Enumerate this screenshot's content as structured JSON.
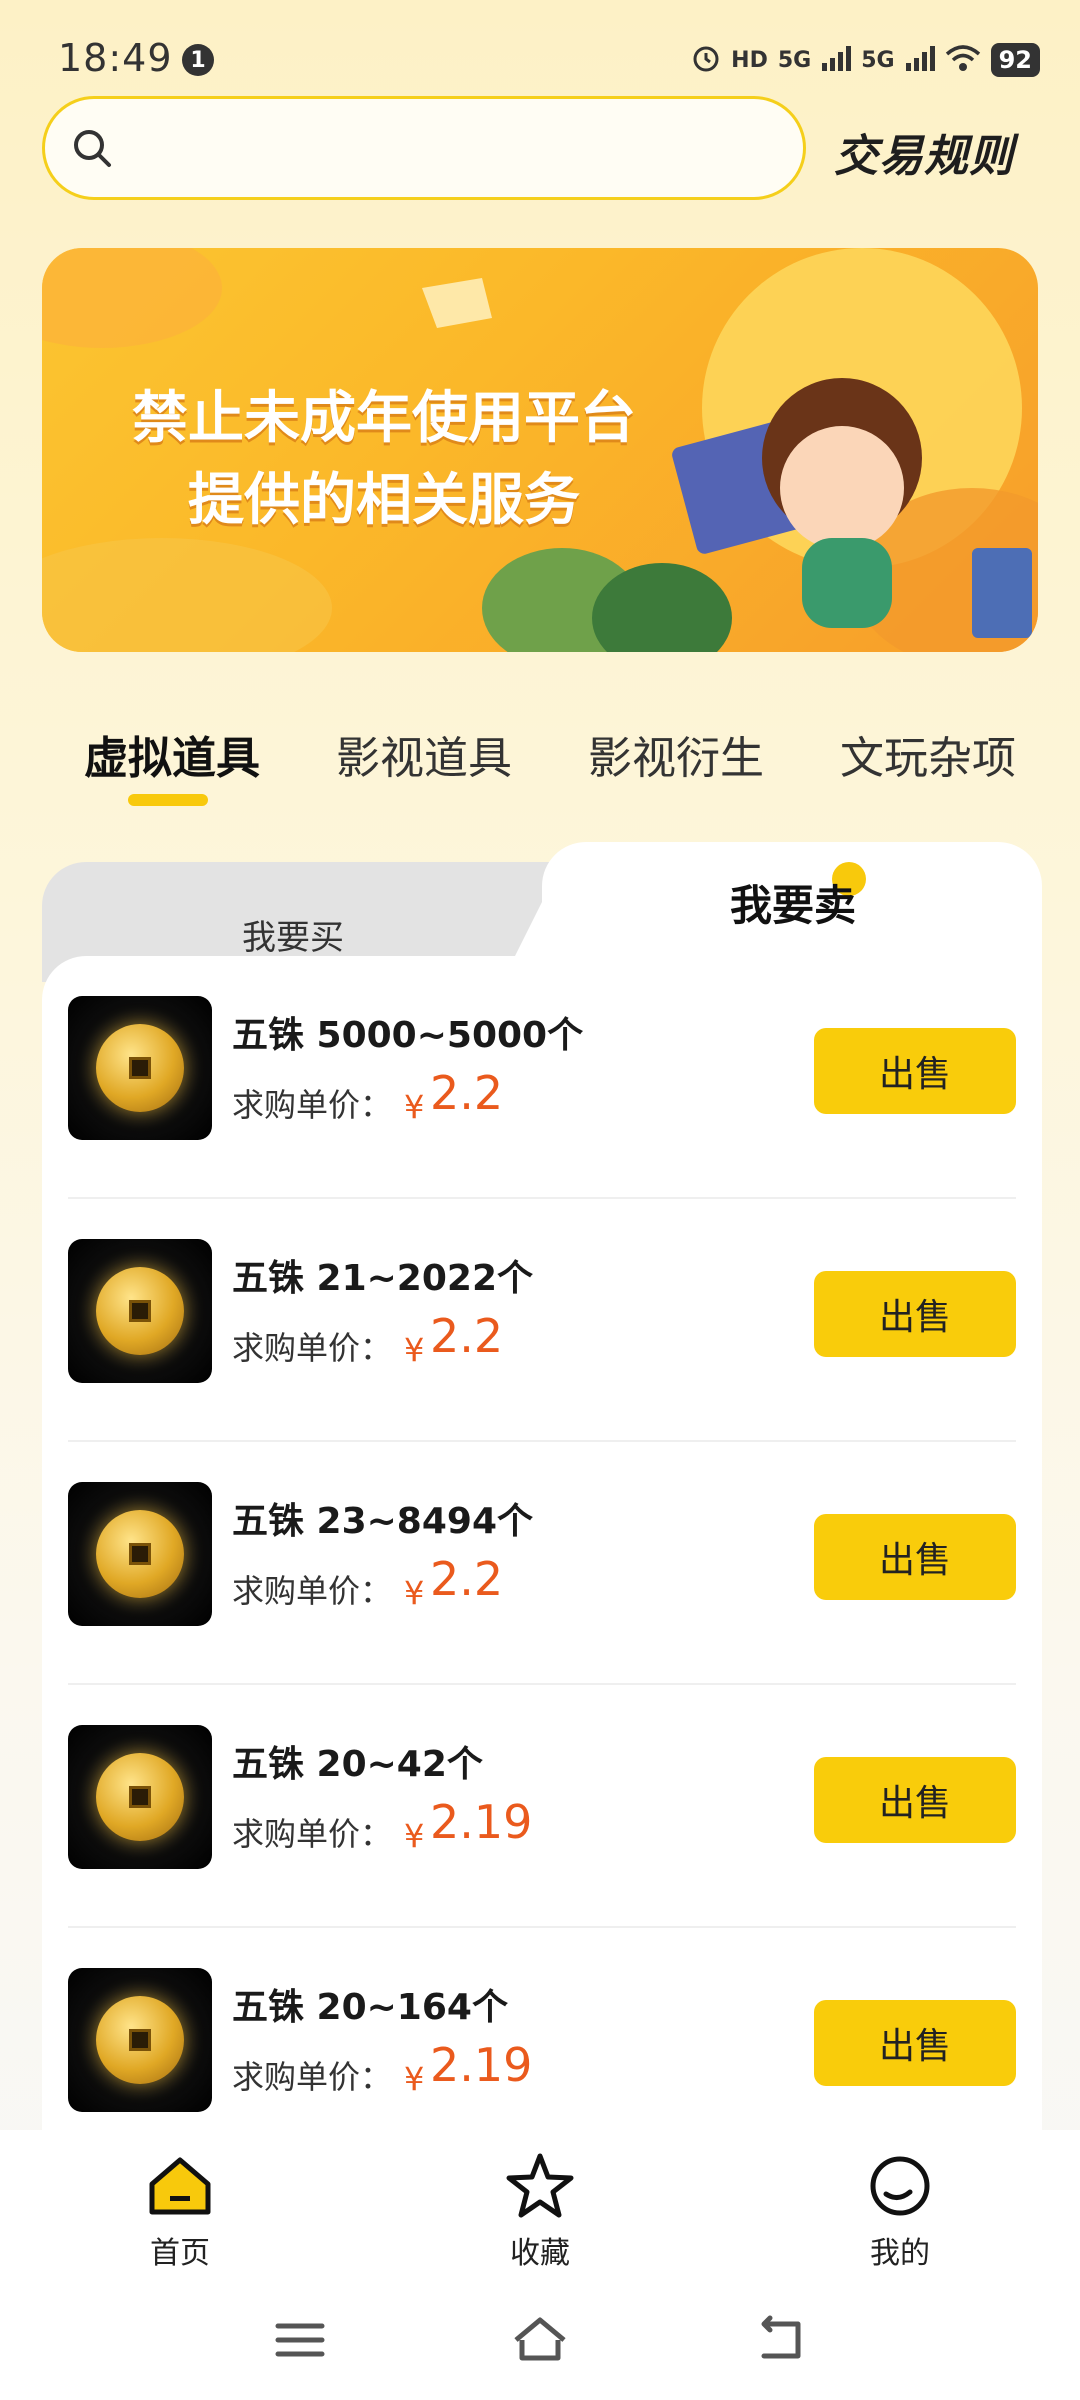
{
  "status_bar": {
    "time": "18:49",
    "notification_count": "1",
    "network_hd": "HD",
    "network_5g_1": "5G",
    "network_5g_2": "5G",
    "battery": "92"
  },
  "search": {
    "placeholder": ""
  },
  "header": {
    "rules_link": "交易规则"
  },
  "banner": {
    "line1": "禁止未成年使用平台",
    "line2": "提供的相关服务"
  },
  "category_tabs": [
    {
      "label": "虚拟道具",
      "active": true
    },
    {
      "label": "影视道具",
      "active": false
    },
    {
      "label": "影视衍生",
      "active": false
    },
    {
      "label": "文玩杂项",
      "active": false
    }
  ],
  "mode_tabs": {
    "buy": "我要买",
    "sell": "我要卖",
    "active": "sell"
  },
  "items": [
    {
      "title": "五铢 5000~5000个",
      "price_label": "求购单价：",
      "currency": "¥",
      "price": "2.2",
      "action": "出售"
    },
    {
      "title": "五铢 21~2022个",
      "price_label": "求购单价：",
      "currency": "¥",
      "price": "2.2",
      "action": "出售"
    },
    {
      "title": "五铢 23~8494个",
      "price_label": "求购单价：",
      "currency": "¥",
      "price": "2.2",
      "action": "出售"
    },
    {
      "title": "五铢 20~42个",
      "price_label": "求购单价：",
      "currency": "¥",
      "price": "2.19",
      "action": "出售"
    },
    {
      "title": "五铢 20~164个",
      "price_label": "求购单价：",
      "currency": "¥",
      "price": "2.19",
      "action": "出售"
    }
  ],
  "bottom_nav": [
    {
      "label": "首页",
      "icon": "home-icon",
      "active": true
    },
    {
      "label": "收藏",
      "icon": "star-icon",
      "active": false
    },
    {
      "label": "我的",
      "icon": "profile-icon",
      "active": false
    }
  ],
  "colors": {
    "accent": "#f8c90c",
    "price": "#ea5a1d"
  }
}
